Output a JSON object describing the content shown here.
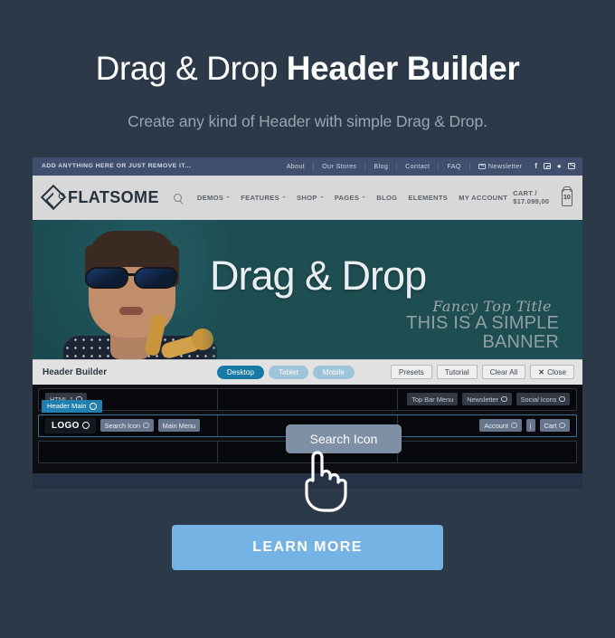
{
  "hero": {
    "title_light": "Drag & Drop ",
    "title_bold": "Header Builder",
    "subtitle": "Create any kind of Header with simple Drag & Drop."
  },
  "site": {
    "topbar": {
      "message": "ADD ANYTHING HERE OR JUST REMOVE IT...",
      "links": [
        "About",
        "Our Stores",
        "Blog",
        "Contact",
        "FAQ"
      ],
      "newsletter": "Newsletter",
      "social": [
        "facebook-icon",
        "instagram-icon",
        "twitter-icon",
        "email-icon"
      ]
    },
    "nav": {
      "logo": "FLATSOME",
      "search_icon": "search-icon",
      "items": [
        {
          "label": "DEMOS",
          "caret": true
        },
        {
          "label": "FEATURES",
          "caret": true
        },
        {
          "label": "SHOP",
          "caret": true
        },
        {
          "label": "PAGES",
          "caret": true
        },
        {
          "label": "BLOG",
          "caret": false
        },
        {
          "label": "ELEMENTS",
          "caret": false
        },
        {
          "label": "MY ACCOUNT",
          "caret": false
        }
      ],
      "cart_label": "CART / $17.099,00",
      "cart_count": "10"
    },
    "banner": {
      "title": "Drag & Drop",
      "fancy": "Fancy Top Title",
      "subtitle": "THIS IS A SIMPLE BANNER"
    }
  },
  "builder": {
    "title": "Header Builder",
    "devices": [
      {
        "label": "Desktop",
        "active": true
      },
      {
        "label": "Tablet",
        "active": false
      },
      {
        "label": "Mobile",
        "active": false
      }
    ],
    "actions": [
      "Presets",
      "Tutorial",
      "Clear All"
    ],
    "close_label": "Close",
    "close_icon": "close-icon",
    "tab_label": "Header Main",
    "rows": [
      {
        "cells": [
          {
            "align": "l",
            "chips": [
              {
                "label": "HTML 1",
                "style": "dark",
                "gear": true
              }
            ]
          },
          {
            "align": "c",
            "chips": []
          },
          {
            "align": "r",
            "chips": [
              {
                "label": "Top Bar Menu",
                "style": "dark",
                "gear": false
              },
              {
                "label": "Newsletter",
                "style": "dark",
                "gear": true
              },
              {
                "label": "Social Icons",
                "style": "dark",
                "gear": true
              }
            ]
          }
        ]
      },
      {
        "selected": true,
        "cells": [
          {
            "align": "l",
            "chips": [
              {
                "label": "LOGO",
                "style": "logo",
                "gear": true
              },
              {
                "label": "Search Icon",
                "style": "lite",
                "gear": true
              },
              {
                "label": "Main Menu",
                "style": "lite",
                "gear": false
              }
            ]
          },
          {
            "align": "c",
            "chips": []
          },
          {
            "align": "r",
            "chips": [
              {
                "label": "Account",
                "style": "lite",
                "gear": true
              },
              {
                "label": "|",
                "style": "bar",
                "gear": false
              },
              {
                "label": "Cart",
                "style": "lite",
                "gear": true
              }
            ]
          }
        ]
      },
      {
        "cells": [
          {
            "align": "l",
            "chips": []
          },
          {
            "align": "c",
            "chips": []
          },
          {
            "align": "r",
            "chips": []
          }
        ]
      }
    ],
    "drag_ghost": "Search Icon",
    "cursor": "pointing-hand-cursor"
  },
  "cta": {
    "label": "LEARN MORE"
  },
  "colors": {
    "page_bg": "#2b3949",
    "topbar_bg": "#3f4f6d",
    "nav_bg": "#d8d8d8",
    "banner_bg": "#1f4e52",
    "toolbar_bg": "#e2e2e2",
    "accent_active": "#1779a5",
    "tab_blue": "#1f7fb0",
    "cta_bg": "#74b3e3",
    "builder_bg": "#0d0f12"
  }
}
